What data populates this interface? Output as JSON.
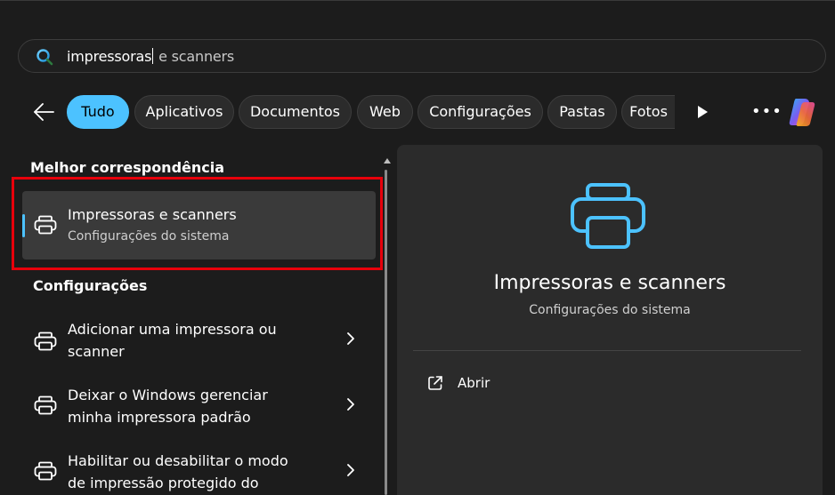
{
  "search": {
    "typed": "impressoras",
    "suggestion": " e scanners"
  },
  "filters": {
    "chips": [
      {
        "label": "Tudo",
        "active": true
      },
      {
        "label": "Aplicativos",
        "active": false
      },
      {
        "label": "Documentos",
        "active": false
      },
      {
        "label": "Web",
        "active": false
      },
      {
        "label": "Configurações",
        "active": false
      },
      {
        "label": "Pastas",
        "active": false
      },
      {
        "label": "Fotos",
        "active": false
      }
    ],
    "icons": {
      "back": "arrow-left-icon",
      "play": "play-icon",
      "more": "more-icon",
      "more_glyph": "•••",
      "copilot": "copilot-icon"
    }
  },
  "results": {
    "best_match_header": "Melhor correspondência",
    "best_match": {
      "title": "Impressoras e scanners",
      "subtitle": "Configurações do sistema",
      "icon": "printer-icon"
    },
    "settings_header": "Configurações",
    "settings_items": [
      {
        "line1": "Adicionar uma impressora ou",
        "line2": "scanner",
        "icon": "printer-icon"
      },
      {
        "line1": "Deixar o Windows gerenciar",
        "line2": "minha impressora padrão",
        "icon": "printer-icon"
      },
      {
        "line1": "Habilitar ou desabilitar o modo",
        "line2": "de impressão protegido do",
        "icon": "printer-icon"
      }
    ]
  },
  "detail": {
    "title": "Impressoras e scanners",
    "subtitle": "Configurações do sistema",
    "action_label": "Abrir",
    "action_icon": "open-external-icon"
  },
  "colors": {
    "accent": "#4cc2ff",
    "highlight_border": "#e8000b",
    "background": "#1c1c1c",
    "card": "#3a3a3a",
    "detail_panel": "#2b2b2b"
  }
}
